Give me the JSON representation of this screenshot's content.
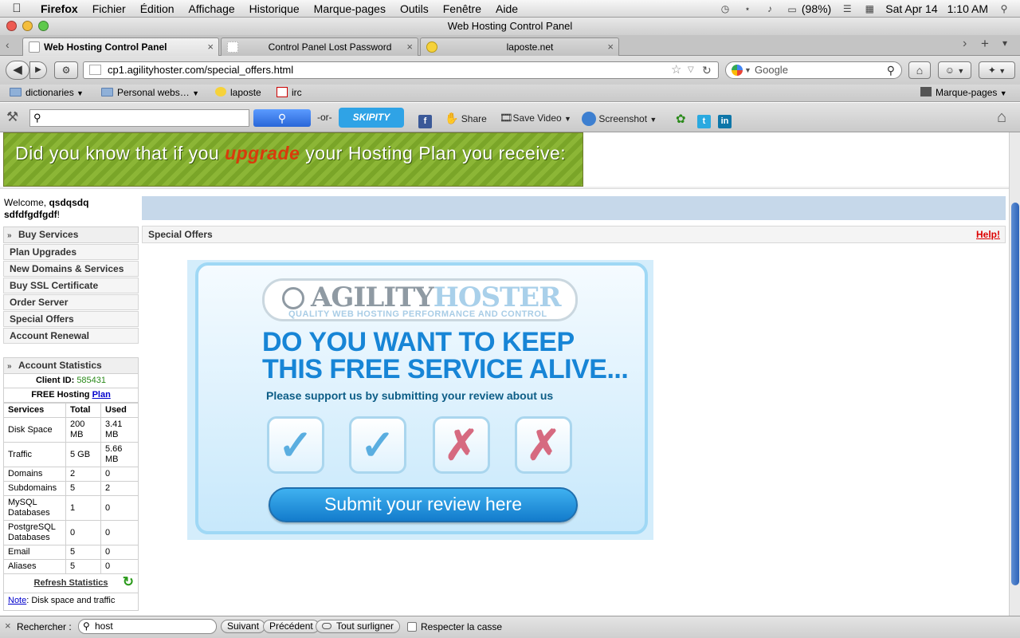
{
  "menubar": {
    "app_name": "Firefox",
    "items": [
      "Fichier",
      "Édition",
      "Affichage",
      "Historique",
      "Marque-pages",
      "Outils",
      "Fenêtre",
      "Aide"
    ],
    "battery": "(98%)",
    "clock_date": "Sat Apr 14",
    "clock_time": "1:10 AM"
  },
  "window": {
    "title": "Web Hosting Control Panel"
  },
  "tabs": [
    {
      "label": "Web Hosting Control Panel",
      "active": true
    },
    {
      "label": "Control Panel Lost Password",
      "active": false
    },
    {
      "label": "laposte.net",
      "active": false
    }
  ],
  "nav": {
    "url": "cp1.agilityhoster.com/special_offers.html",
    "search_engine": "Google"
  },
  "bookmarks": [
    {
      "label": "dictionaries",
      "type": "folder"
    },
    {
      "label": "Personal webs…",
      "type": "folder"
    },
    {
      "label": "laposte",
      "type": "link"
    },
    {
      "label": "irc",
      "type": "link"
    }
  ],
  "bookmarks_menu": "Marque-pages",
  "skipity": {
    "or_text": "-or-",
    "brand": "SKIPITY",
    "share": "Share",
    "save_video": "Save Video",
    "screenshot": "Screenshot",
    "fb_icon": "f",
    "tw_icon": "t",
    "li_icon": "in"
  },
  "banner": {
    "prefix": "Did you know that if you ",
    "highlight": "upgrade",
    "suffix": " your Hosting Plan you receive:"
  },
  "welcome": {
    "label": "Welcome, ",
    "user": "qsdqsdq sdfdfgdfgdf",
    "suffix": "!"
  },
  "sidebar": {
    "header": "Buy Services",
    "items": [
      "Plan Upgrades",
      "New Domains & Services",
      "Buy SSL Certificate",
      "Order Server",
      "Special Offers",
      "Account Renewal"
    ]
  },
  "section": {
    "title": "Special Offers",
    "help": "Help!"
  },
  "stats": {
    "header": "Account Statistics",
    "client_id_label": "Client ID: ",
    "client_id": "585431",
    "plan_label": "FREE Hosting ",
    "plan_link": "Plan",
    "columns": [
      "Services",
      "Total",
      "Used"
    ],
    "rows": [
      [
        "Disk Space",
        "200 MB",
        "3.41 MB"
      ],
      [
        "Traffic",
        "5 GB",
        "5.66 MB"
      ],
      [
        "Domains",
        "2",
        "0"
      ],
      [
        "Subdomains",
        "5",
        "2"
      ],
      [
        "MySQL Databases",
        "1",
        "0"
      ],
      [
        "PostgreSQL Databases",
        "0",
        "0"
      ],
      [
        "Email",
        "5",
        "0"
      ],
      [
        "Aliases",
        "5",
        "0"
      ]
    ],
    "refresh": "Refresh Statistics",
    "note_link": "Note",
    "note_text": ": Disk space and traffic"
  },
  "promo": {
    "logo_part1": "AGILITY",
    "logo_part2": "HOSTER",
    "logo_tagline": "QUALITY WEB HOSTING PERFORMANCE AND CONTROL",
    "headline1": "DO YOU WANT TO KEEP",
    "headline2": "THIS FREE SERVICE ALIVE...",
    "subline": "Please support us by submitting your review about us",
    "button": "Submit your review here"
  },
  "findbar": {
    "label": "Rechercher :",
    "query": "host",
    "next": "Suivant",
    "prev": "Précédent",
    "highlight_all": "Tout surligner",
    "match_case": "Respecter la casse"
  }
}
